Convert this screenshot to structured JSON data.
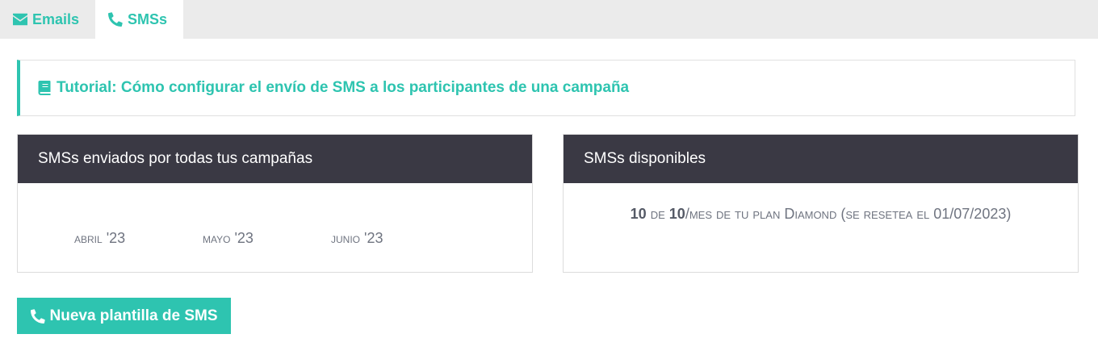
{
  "tabs": [
    {
      "label": "Emails",
      "icon": "envelope-icon",
      "active": false
    },
    {
      "label": "SMSs",
      "icon": "phone-icon",
      "active": true
    }
  ],
  "tutorial": {
    "icon": "book-icon",
    "link_text": "Tutorial: Cómo configurar el envío de SMS a los participantes de una campaña"
  },
  "sent_panel": {
    "title": "SMSs enviados por todas tus campañas",
    "months": [
      {
        "name": "abril",
        "year": "'23"
      },
      {
        "name": "mayo",
        "year": "'23"
      },
      {
        "name": "junio",
        "year": "'23"
      }
    ]
  },
  "available_panel": {
    "title": "SMSs disponibles",
    "used": "10",
    "de": "de",
    "total": "10",
    "suffix": "/mes de tu plan Diamond (se resetea el 01/07/2023)"
  },
  "new_button": {
    "label": "Nueva plantilla de SMS",
    "icon": "phone-icon"
  },
  "colors": {
    "accent": "#2ec4b0",
    "panel_header": "#3a3944",
    "tabbar": "#ebebeb"
  }
}
